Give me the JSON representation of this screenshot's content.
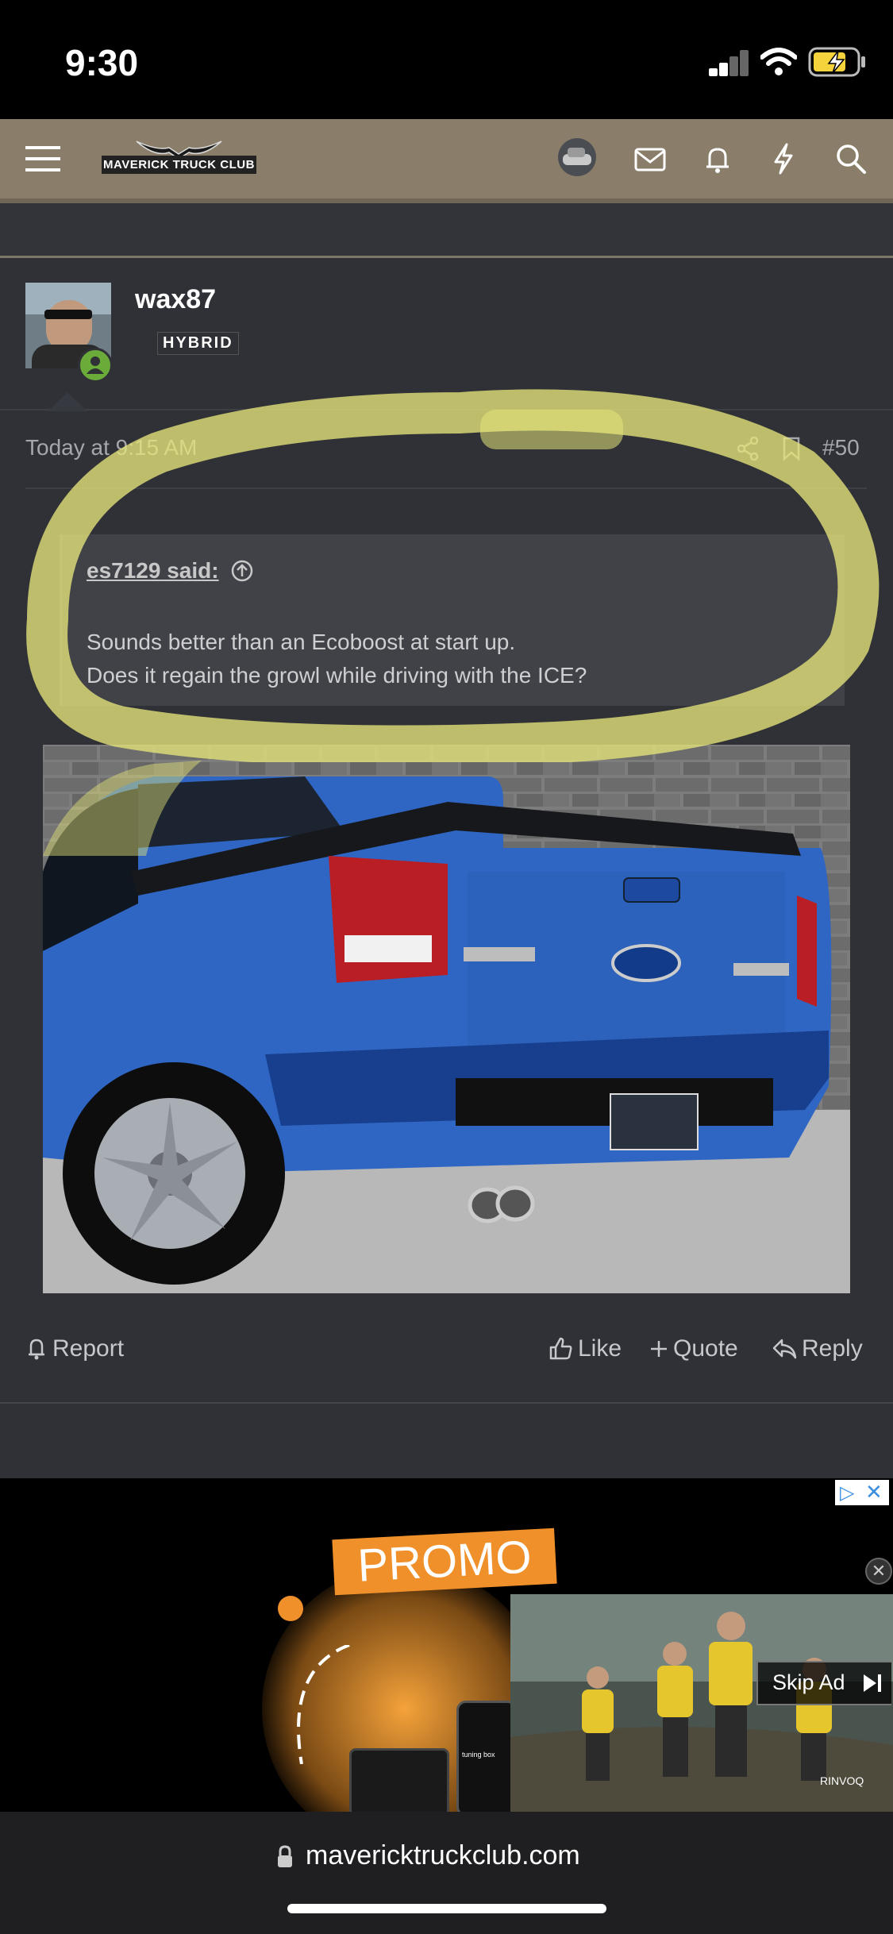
{
  "status_bar": {
    "time": "9:30"
  },
  "header": {
    "logo_text": "MAVERICK TRUCK CLUB",
    "icons": [
      "menu-icon",
      "avatar-thumb",
      "mail-icon",
      "bell-icon",
      "lightning-icon",
      "search-icon"
    ],
    "colors": {
      "background": "#8a7e6a"
    }
  },
  "post": {
    "username": "wax87",
    "user_badge": "HYBRID",
    "date": "Today at 9:15 AM",
    "number": "#50",
    "quote": {
      "author": "es7129 said:",
      "line1": "Sounds better than an Ecoboost at start up.",
      "line2": "Does it regain the growl while driving with the ICE?"
    },
    "actions": {
      "report": "Report",
      "like": "Like",
      "quote": "Quote",
      "reply": "Reply"
    }
  },
  "ad": {
    "promo_label": "PROMO",
    "skip_label": "Skip Ad",
    "brand_small": "RINVOQ",
    "tuning_label": "tuning box"
  },
  "browser": {
    "url": "mavericktruckclub.com"
  },
  "colors": {
    "highlight": "#e6e67a",
    "truck_blue": "#2f66c4",
    "online": "#6bab3a"
  }
}
